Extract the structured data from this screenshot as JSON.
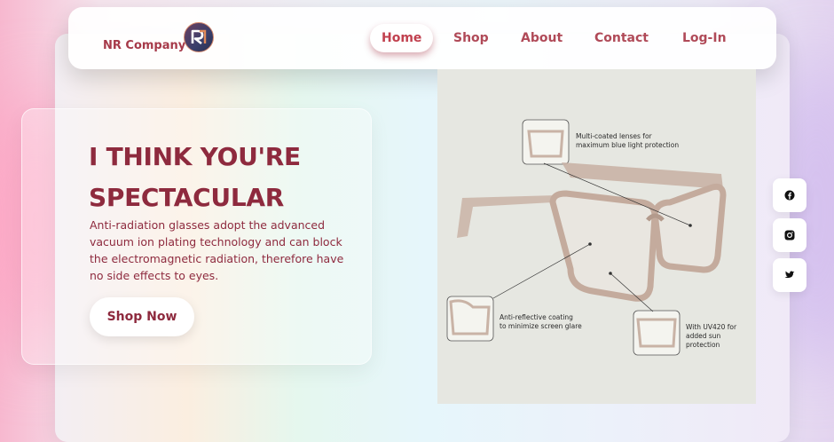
{
  "brand": {
    "name": "NR Company",
    "logo_letters": "NR"
  },
  "nav": {
    "items": [
      {
        "label": "Home",
        "active": true
      },
      {
        "label": "Shop"
      },
      {
        "label": "About"
      },
      {
        "label": "Contact"
      },
      {
        "label": "Log-In"
      }
    ]
  },
  "hero": {
    "title_line1": "I THINK YOU'RE",
    "title_line2": "SPECTACULAR",
    "description": "Anti-radiation glasses adopt the advanced vacuum ion plating technology and can block the electromagnetic radiation, therefore have no side effects to eyes.",
    "cta_label": "Shop Now"
  },
  "product": {
    "annotations": {
      "top_line1": "Multi-coated lenses for",
      "top_line2": "maximum blue light protection",
      "left_line1": "Anti-reflective coating",
      "left_line2": "to minimize screen glare",
      "right_line1": "With UV420 for",
      "right_line2": "added sun protection"
    }
  },
  "social": [
    "facebook-icon",
    "instagram-icon",
    "twitter-icon"
  ],
  "colors": {
    "accent": "#8e2a3e",
    "nav_text": "#b04a58",
    "frame": "#c9b3a6"
  }
}
